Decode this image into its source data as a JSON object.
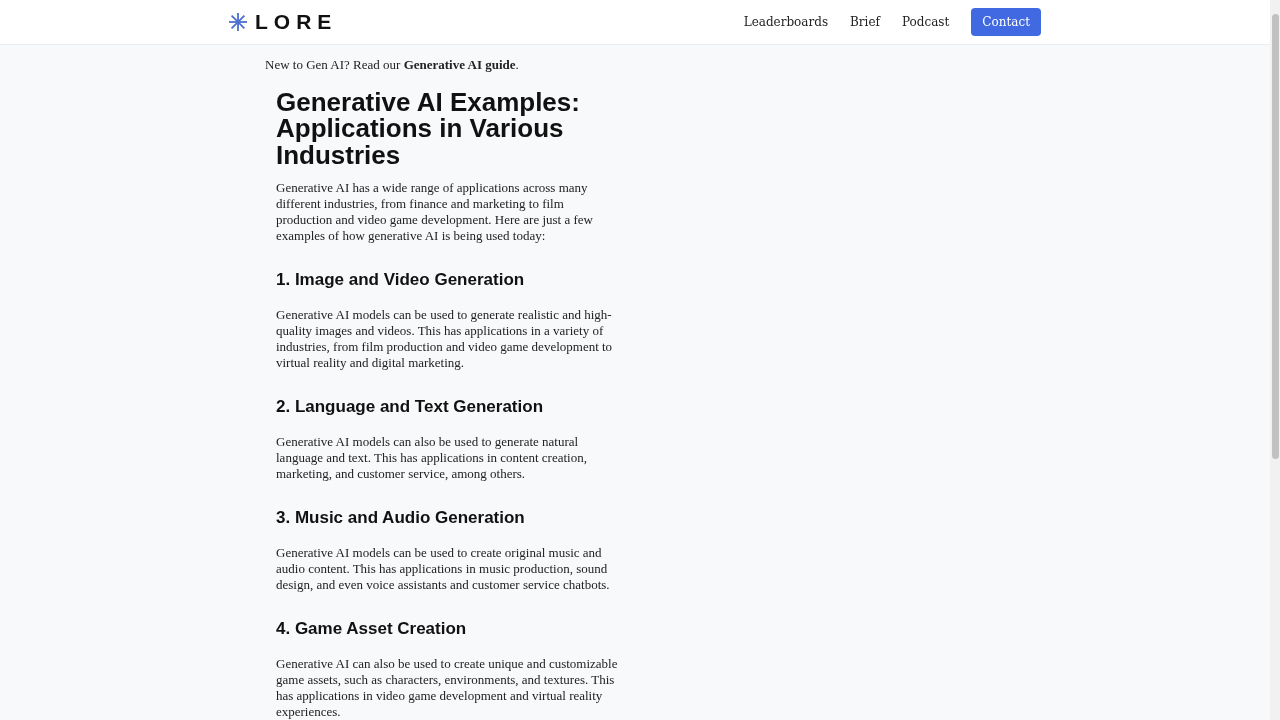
{
  "header": {
    "logo": "LORE",
    "nav": [
      {
        "label": "Leaderboards",
        "kind": "link"
      },
      {
        "label": "Brief",
        "kind": "link"
      },
      {
        "label": "Podcast",
        "kind": "link"
      },
      {
        "label": "Contact",
        "kind": "button"
      }
    ]
  },
  "notice": "New to Gen AI? Read our **Generative AI guide**.",
  "article": {
    "title": "Generative AI Examples: Applications in Various Industries",
    "intro": "Generative AI has a wide range of applications across many different industries, from finance and marketing to film production and video game development. Here are just a few examples of how generative AI is being used today:",
    "sections": [
      {
        "heading": "1. Image and Video Generation",
        "body": "Generative AI models can be used to generate realistic and high-quality images and videos. This has applications in a variety of industries, from film production and video game development to virtual reality and digital marketing."
      },
      {
        "heading": "2. Language and Text Generation",
        "body": "Generative AI models can also be used to generate natural language and text. This has applications in content creation, marketing, and customer service, among others."
      },
      {
        "heading": "3. Music and Audio Generation",
        "body": "Generative AI models can be used to create original music and audio content. This has applications in music production, sound design, and even voice assistants and customer service chatbots."
      },
      {
        "heading": "4. Game Asset Creation",
        "body": "Generative AI can also be used to create unique and customizable game assets, such as characters, environments, and textures. This has applications in video game development and virtual reality experiences."
      }
    ]
  }
}
